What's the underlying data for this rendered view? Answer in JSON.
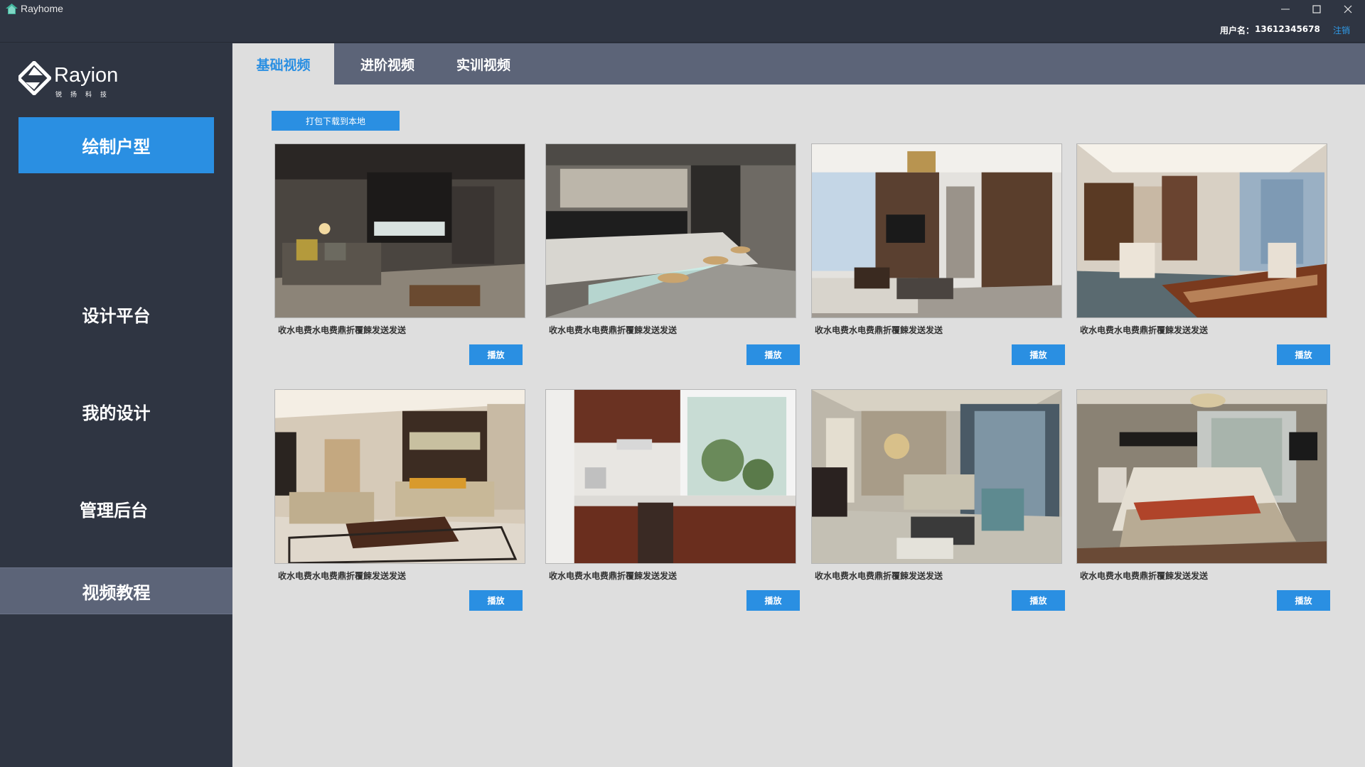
{
  "window": {
    "title": "Rayhome",
    "icon": "house-icon"
  },
  "infobar": {
    "user_label": "用户名：",
    "user_value": "13612345678",
    "logout": "注销"
  },
  "sidebar": {
    "logo_text": "Rayion",
    "logo_sub": "锐扬科技",
    "draw_label": "绘制户型",
    "items": [
      {
        "label": "设计平台"
      },
      {
        "label": "我的设计"
      },
      {
        "label": "管理后台"
      },
      {
        "label": "视频教程"
      }
    ]
  },
  "tabs": [
    {
      "label": "基础视频",
      "active": true
    },
    {
      "label": "进阶视频",
      "active": false
    },
    {
      "label": "实训视频",
      "active": false
    }
  ],
  "download_label": "打包下载到本地",
  "videos": [
    {
      "caption": "收水电费水电费鼎折覆餗发送发送",
      "play": "播放",
      "scene": "loft-living-room"
    },
    {
      "caption": "收水电费水电费鼎折覆餗发送发送",
      "play": "播放",
      "scene": "kitchen-bar"
    },
    {
      "caption": "收水电费水电费鼎折覆餗发送发送",
      "play": "播放",
      "scene": "living-room-tv-wall"
    },
    {
      "caption": "收水电费水电费鼎折覆餗发送发送",
      "play": "播放",
      "scene": "office-meeting"
    },
    {
      "caption": "收水电费水电费鼎折覆餗发送发送",
      "play": "播放",
      "scene": "living-room-sofa"
    },
    {
      "caption": "收水电费水电费鼎折覆餗发送发送",
      "play": "播放",
      "scene": "wooden-kitchen"
    },
    {
      "caption": "收水电费水电费鼎折覆餗发送发送",
      "play": "播放",
      "scene": "european-living-room"
    },
    {
      "caption": "收水电费水电费鼎折覆餗发送发送",
      "play": "播放",
      "scene": "bedroom"
    }
  ],
  "colors": {
    "accent": "#2a8fe2",
    "sidebar_bg": "#2f3542",
    "tabbar_bg": "#5c6478",
    "content_bg": "#dedede"
  }
}
